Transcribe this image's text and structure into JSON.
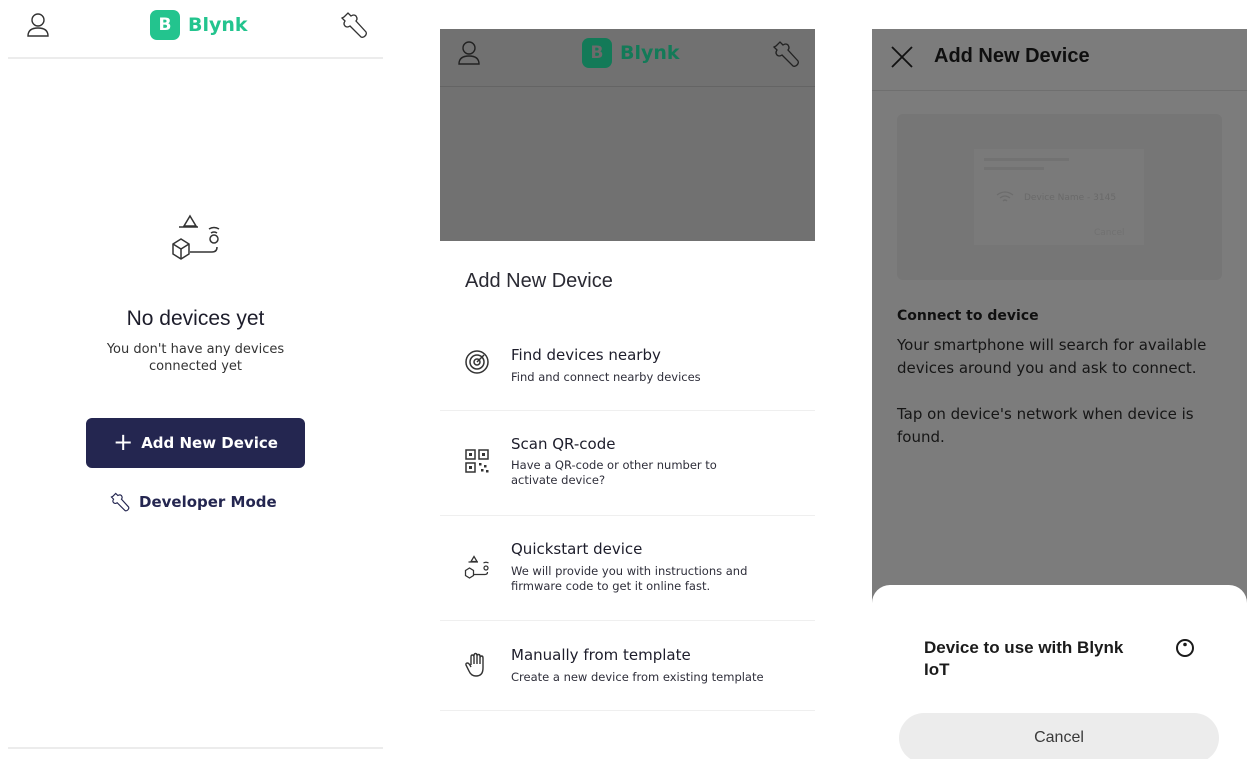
{
  "panel1": {
    "brand": {
      "letter": "B",
      "name": "Blynk"
    },
    "empty_title": "No devices yet",
    "empty_subtitle": "You don't have any devices connected yet",
    "add_button": "Add New Device",
    "developer_link": "Developer Mode"
  },
  "panel2": {
    "brand": {
      "letter": "B",
      "name": "Blynk"
    },
    "sheet_title": "Add New Device",
    "options": [
      {
        "title": "Find devices nearby",
        "desc": "Find and connect nearby devices",
        "icon": "radar-icon"
      },
      {
        "title": "Scan QR-code",
        "desc": "Have a QR-code or other number to activate device?",
        "icon": "qr-code-icon"
      },
      {
        "title": "Quickstart device",
        "desc": "We will provide you with instructions and firmware code to get it online fast.",
        "icon": "quickstart-icon"
      },
      {
        "title": "Manually from template",
        "desc": "Create a new device from existing template",
        "icon": "hand-icon"
      }
    ]
  },
  "panel3": {
    "title": "Add New Device",
    "illustration": {
      "device_name": "Device Name - 3145",
      "cancel": "Cancel"
    },
    "connect_title": "Connect to device",
    "connect_text": "Your smartphone will search for available devices around you and ask to connect.",
    "tap_text": "Tap on device's network when device is found.",
    "sheet": {
      "device_label": "Device to use with Blynk IoT",
      "cancel": "Cancel"
    }
  },
  "colors": {
    "brand_green": "#23c48e",
    "primary_dark": "#242650",
    "overlay_grey": "#717171"
  }
}
